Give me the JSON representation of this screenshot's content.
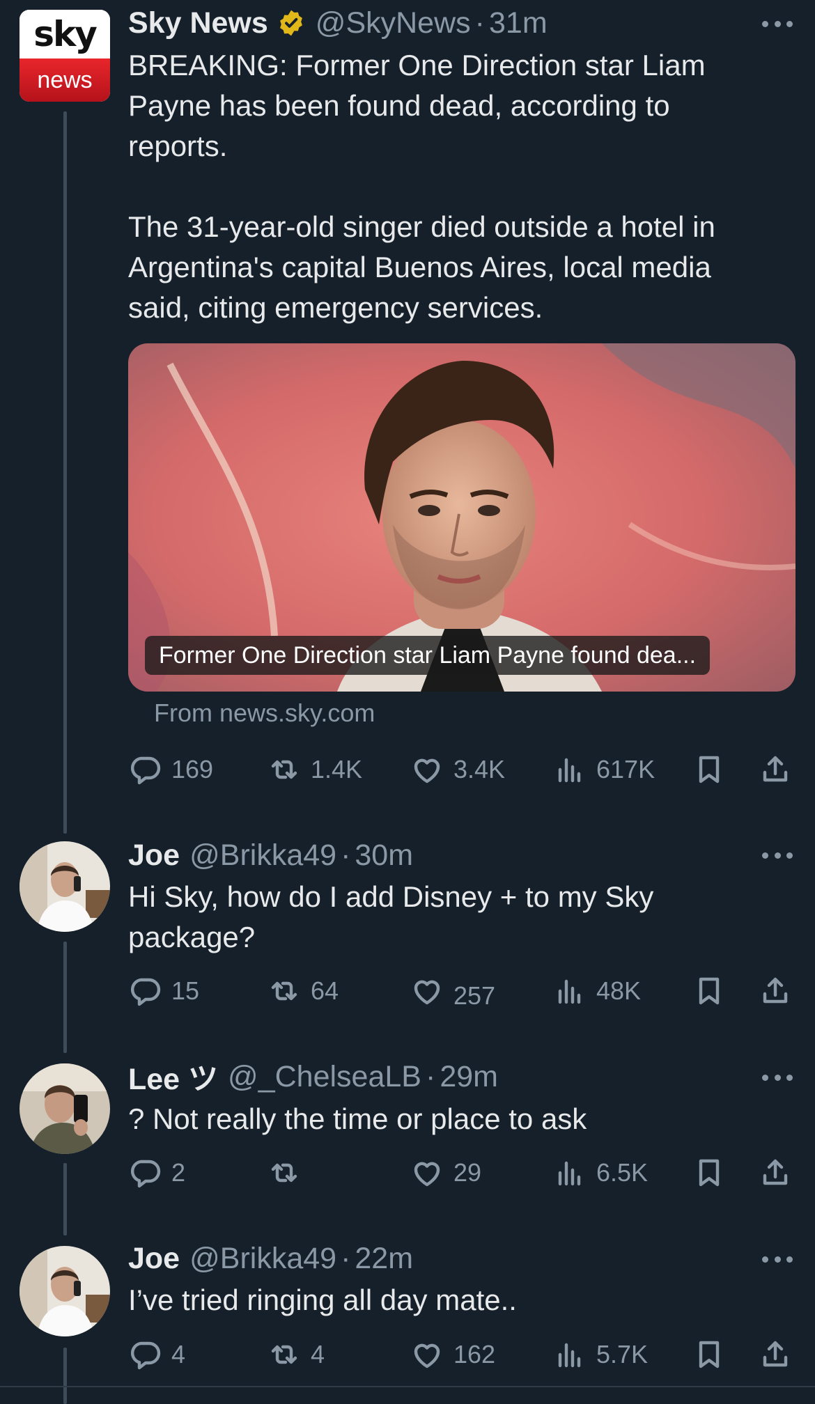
{
  "tweets": [
    {
      "name": "Sky News",
      "handle": "@SkyNews",
      "dot": "·",
      "time": "31m",
      "verified": true,
      "avatar_logo": {
        "top": "sky",
        "bottom": "news"
      },
      "text": "BREAKING: Former One Direction star Liam Payne has been found dead, according to reports.\n\nThe 31-year-old singer died outside a hotel in Argentina's capital Buenos Aires, local media said, citing emergency services.",
      "card": {
        "caption": "Former One Direction star Liam Payne found dea...",
        "from": "From news.sky.com"
      },
      "stats": {
        "replies": "169",
        "reposts": "1.4K",
        "likes": "3.4K",
        "views": "617K"
      }
    },
    {
      "name": "Joe",
      "handle": "@Brikka49",
      "dot": "·",
      "time": "30m",
      "text": "Hi Sky, how do I add Disney + to my Sky package?",
      "stats": {
        "replies": "15",
        "reposts": "64",
        "likes": "257",
        "views": "48K"
      }
    },
    {
      "name": "Lee ツ",
      "handle": "@_ChelseaLB",
      "dot": "·",
      "time": "29m",
      "text": "? Not really the time or place to ask",
      "stats": {
        "replies": "2",
        "reposts": "",
        "likes": "29",
        "views": "6.5K"
      }
    },
    {
      "name": "Joe",
      "handle": "@Brikka49",
      "dot": "·",
      "time": "22m",
      "text": "I’ve tried ringing all day mate..",
      "stats": {
        "replies": "4",
        "reposts": "4",
        "likes": "162",
        "views": "5.7K"
      }
    }
  ],
  "icons": [
    "reply-icon",
    "repost-icon",
    "like-icon",
    "views-icon",
    "bookmark-icon",
    "share-icon",
    "more-icon",
    "verified-badge-icon"
  ],
  "colors": {
    "background": "#15202b",
    "text": "#e7e9ea",
    "secondary": "#8b98a5",
    "thread_line": "#3e4c5a",
    "verified": "#e2b719"
  }
}
